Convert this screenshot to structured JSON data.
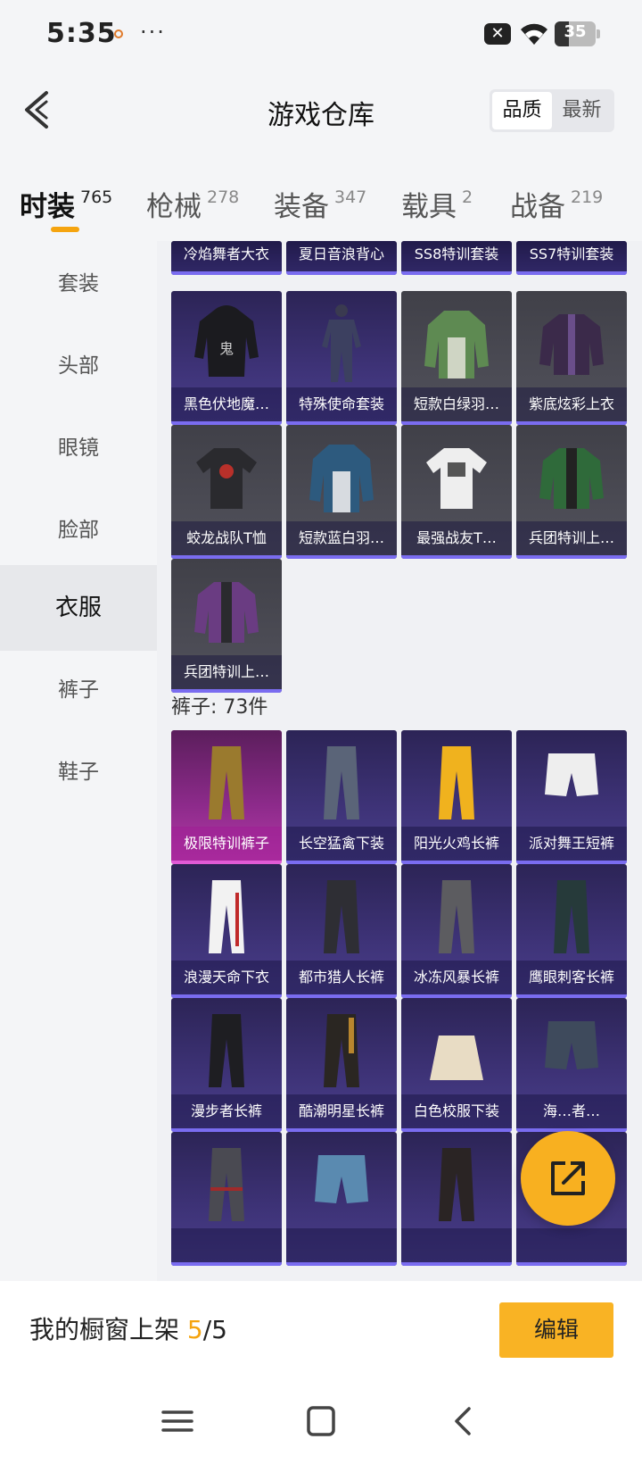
{
  "status": {
    "time": "5:35",
    "more": "···",
    "battery": "35"
  },
  "header": {
    "title": "游戏仓库",
    "sort": [
      "品质",
      "最新"
    ]
  },
  "tabs": [
    {
      "label": "时装",
      "count": "765"
    },
    {
      "label": "枪械",
      "count": "278"
    },
    {
      "label": "装备",
      "count": "347"
    },
    {
      "label": "载具",
      "count": "2"
    },
    {
      "label": "战备",
      "count": "219"
    }
  ],
  "sidebar": [
    "套装",
    "头部",
    "眼镜",
    "脸部",
    "衣服",
    "裤子",
    "鞋子"
  ],
  "clothes_top_row": [
    "冷焰舞者大衣",
    "夏日音浪背心",
    "SS8特训套装",
    "SS7特训套装"
  ],
  "clothes": [
    "黑色伏地魔…",
    "特殊使命套装",
    "短款白绿羽…",
    "紫底炫彩上衣",
    "蛟龙战队T恤",
    "短款蓝白羽…",
    "最强战友T…",
    "兵团特训上…",
    "兵团特训上…"
  ],
  "pants_section": "裤子: 73件",
  "pants": [
    "极限特训裤子",
    "长空猛禽下装",
    "阳光火鸡长裤",
    "派对舞王短裤",
    "浪漫天命下衣",
    "都市猎人长裤",
    "冰冻风暴长裤",
    "鹰眼刺客长裤",
    "漫步者长裤",
    "酷潮明星长裤",
    "白色校服下装",
    "海…者…",
    "",
    "",
    "",
    ""
  ],
  "bottom": {
    "showcase_label": "我的橱窗上架 ",
    "showcase_used": "5",
    "showcase_total": "/5",
    "edit": "编辑"
  },
  "icons": [
    "back-icon",
    "share-icon",
    "menu-icon",
    "home-icon",
    "nav-back-icon",
    "wifi-icon",
    "close-box-icon"
  ]
}
